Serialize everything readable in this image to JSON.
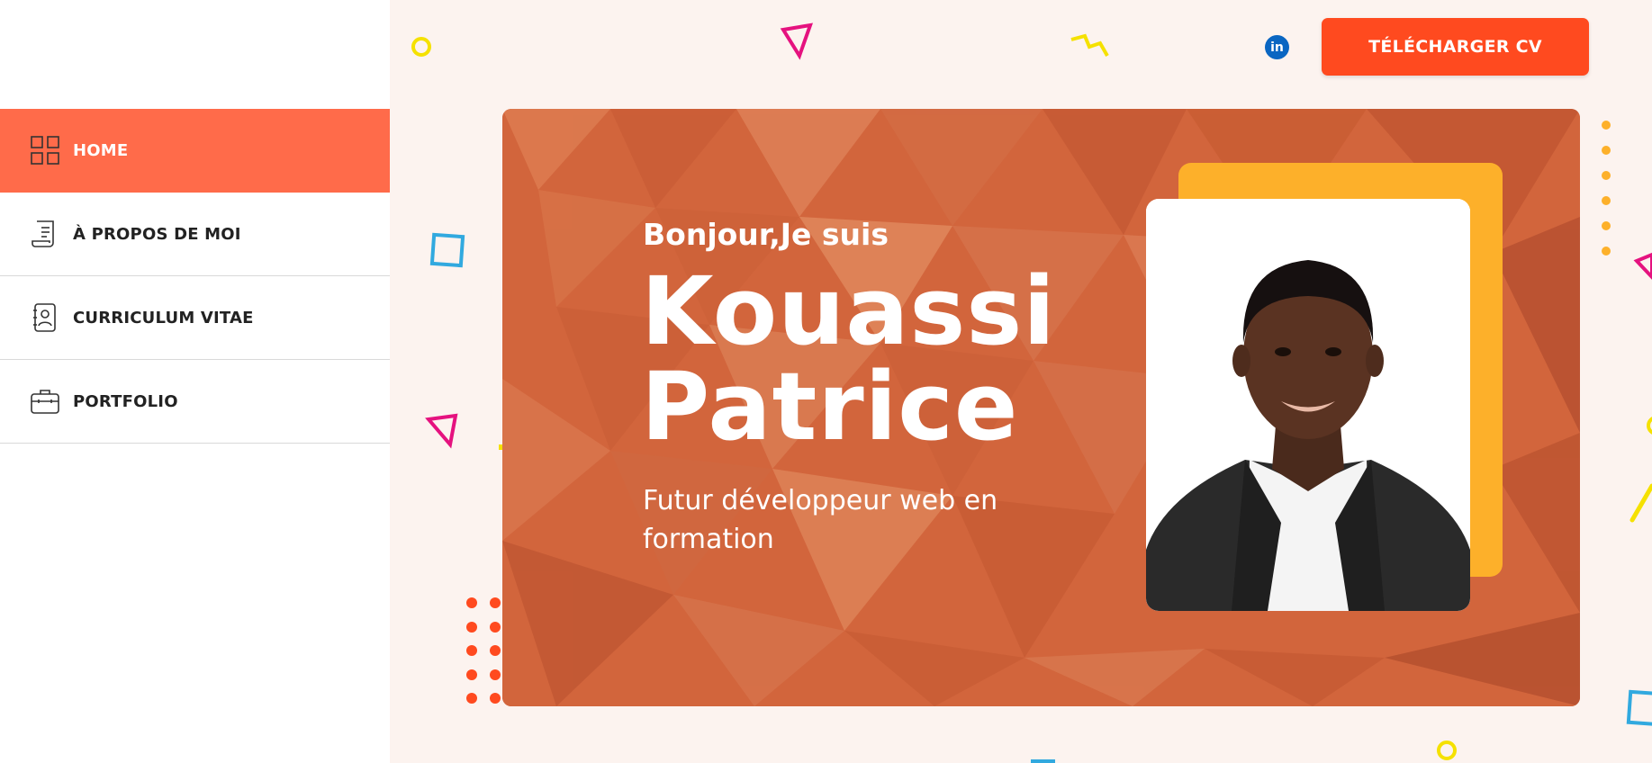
{
  "nav": {
    "items": [
      {
        "label": "HOME",
        "icon": "grid-icon",
        "active": true
      },
      {
        "label": "À PROPOS DE MOI",
        "icon": "document-icon",
        "active": false
      },
      {
        "label": "CURRICULUM VITAE",
        "icon": "contact-card-icon",
        "active": false
      },
      {
        "label": "PORTFOLIO",
        "icon": "briefcase-icon",
        "active": false
      }
    ]
  },
  "header": {
    "download_label": "TÉLÉCHARGER CV",
    "linkedin_text": "in"
  },
  "hero": {
    "greeting": "Bonjour,Je suis",
    "name_line1": "Kouassi",
    "name_line2": "Patrice",
    "tagline": "Futur développeur web en formation"
  },
  "colors": {
    "accent": "#ff6b4a",
    "button": "#ff4a1f",
    "hero_bg": "#d2653c",
    "photo_frame": "#fdb02a",
    "linkedin": "#0a66c2"
  }
}
